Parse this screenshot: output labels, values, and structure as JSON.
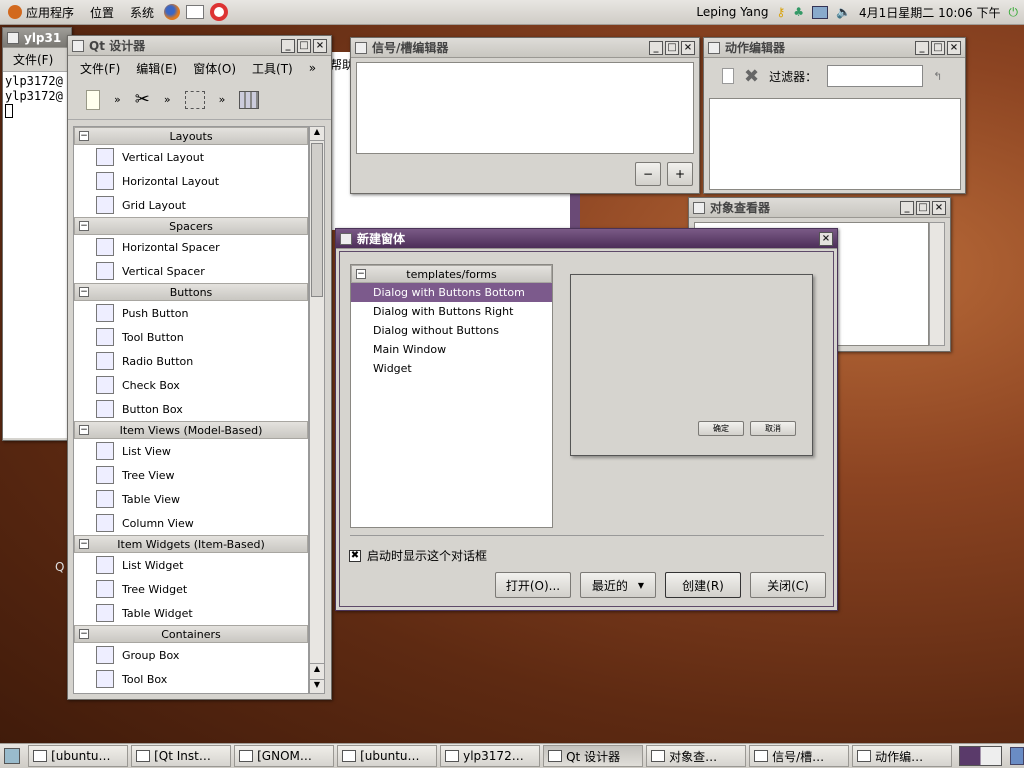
{
  "top_panel": {
    "menus": [
      "应用程序",
      "位置",
      "系统"
    ],
    "user": "Leping Yang",
    "datetime": "4月1日星期二 10:06 下午"
  },
  "terminal": {
    "title": "ylp31",
    "menu_file": "文件(F)",
    "lines": [
      "ylp3172@",
      "ylp3172@"
    ]
  },
  "qt_designer": {
    "title": "Qt 设计器",
    "menus": [
      "文件(F)",
      "编辑(E)",
      "窗体(O)",
      "工具(T)"
    ],
    "more": "»",
    "categories": [
      {
        "name": "Layouts",
        "items": [
          "Vertical Layout",
          "Horizontal Layout",
          "Grid Layout"
        ]
      },
      {
        "name": "Spacers",
        "items": [
          "Horizontal Spacer",
          "Vertical Spacer"
        ]
      },
      {
        "name": "Buttons",
        "items": [
          "Push Button",
          "Tool Button",
          "Radio Button",
          "Check Box",
          "Button Box"
        ]
      },
      {
        "name": "Item Views (Model-Based)",
        "items": [
          "List View",
          "Tree View",
          "Table View",
          "Column View"
        ]
      },
      {
        "name": "Item Widgets (Item-Based)",
        "items": [
          "List Widget",
          "Tree Widget",
          "Table Widget"
        ]
      },
      {
        "name": "Containers",
        "items": [
          "Group Box",
          "Tool Box"
        ]
      }
    ]
  },
  "signal_editor": {
    "title": "信号/槽编辑器",
    "help_fragment": "帮助"
  },
  "action_editor": {
    "title": "动作编辑器",
    "filter_label": "过滤器："
  },
  "object_inspector": {
    "title": "对象查看器"
  },
  "desktop_label": "Q",
  "new_form": {
    "title": "新建窗体",
    "tree_root": "templates/forms",
    "templates": [
      "Dialog with Buttons Bottom",
      "Dialog with Buttons Right",
      "Dialog without Buttons",
      "Main Window",
      "Widget"
    ],
    "preview_ok": "确定",
    "preview_cancel": "取消",
    "show_on_start": "启动时显示这个对话框",
    "buttons": {
      "open": "打开(O)...",
      "recent": "最近的",
      "create": "创建(R)",
      "close": "关闭(C)"
    }
  },
  "taskbar": [
    {
      "label": "[ubuntu…",
      "active": false
    },
    {
      "label": "[Qt Inst…",
      "active": false
    },
    {
      "label": "[GNOM…",
      "active": false
    },
    {
      "label": "[ubuntu…",
      "active": false
    },
    {
      "label": "ylp3172…",
      "active": false
    },
    {
      "label": "Qt 设计器",
      "active": true
    },
    {
      "label": "对象查…",
      "active": false
    },
    {
      "label": "信号/槽…",
      "active": false
    },
    {
      "label": "动作编…",
      "active": false
    }
  ]
}
